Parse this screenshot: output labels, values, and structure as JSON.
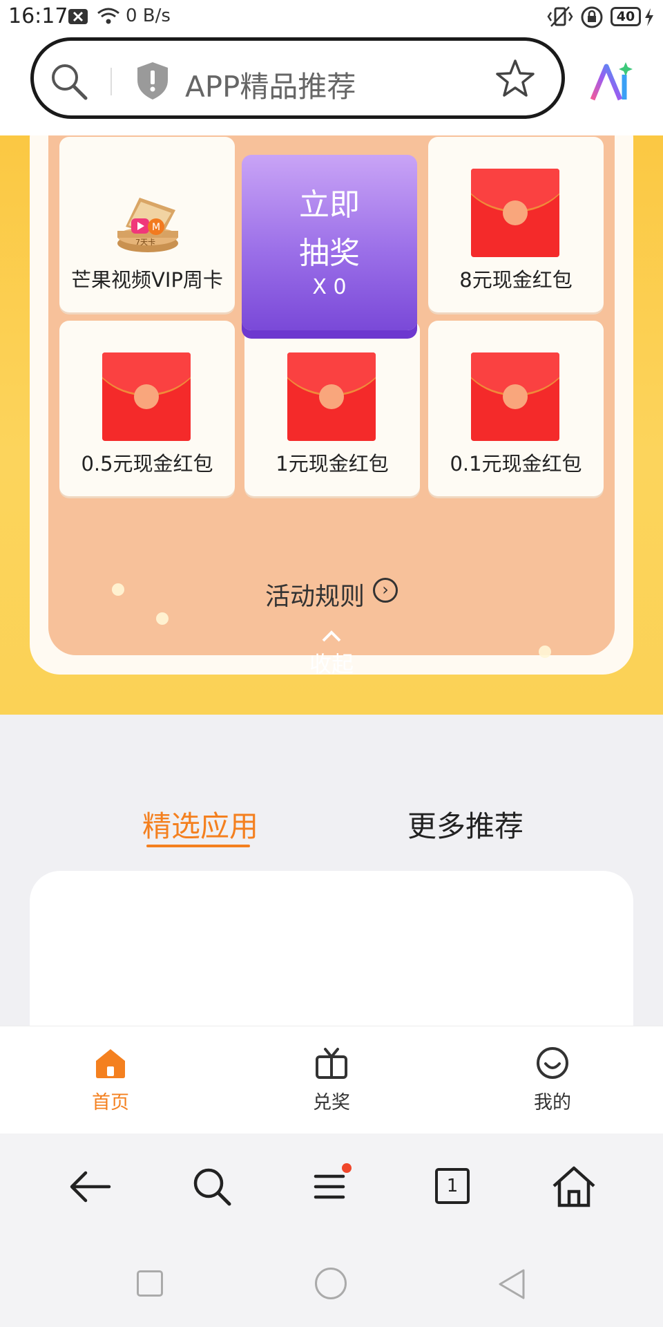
{
  "status_bar": {
    "time": "16:17",
    "network_speed": "0 B/s",
    "battery": "40"
  },
  "address_bar": {
    "text": "APP精品推荐"
  },
  "lottery": {
    "cells": [
      {
        "label": "芒果视频VIP周卡",
        "type": "vip-card",
        "badge": "7天卡"
      },
      {
        "label": "8元现金红包",
        "type": "red-envelope"
      },
      {
        "label": "0.5元现金红包",
        "type": "red-envelope"
      },
      {
        "label": "1元现金红包",
        "type": "red-envelope"
      },
      {
        "label": "0.1元现金红包",
        "type": "red-envelope"
      }
    ],
    "draw_button": {
      "line1": "立即",
      "line2": "抽奖",
      "count": "X 0"
    },
    "rules_label": "活动规则",
    "collapse_label": "收起"
  },
  "tabs": [
    {
      "label": "精选应用",
      "active": true
    },
    {
      "label": "更多推荐",
      "active": false
    }
  ],
  "app_nav": [
    {
      "label": "首页",
      "icon": "home-icon",
      "active": true
    },
    {
      "label": "兑奖",
      "icon": "gift-box-icon",
      "active": false
    },
    {
      "label": "我的",
      "icon": "smiley-icon",
      "active": false
    }
  ],
  "browser_toolbar": {
    "icons": [
      "back-arrow-icon",
      "search-icon",
      "menu-icon",
      "tabs-icon",
      "home-icon"
    ],
    "tab_count": "1",
    "menu_has_notification": true
  },
  "system_nav": {
    "icons": [
      "recents-square-icon",
      "home-circle-icon",
      "back-triangle-icon"
    ]
  },
  "colors": {
    "accent_orange": "#f4801f",
    "promo_yellow": "#fbc843",
    "envelope_red": "#f42a2a",
    "draw_purple": "#9b6fe8"
  }
}
